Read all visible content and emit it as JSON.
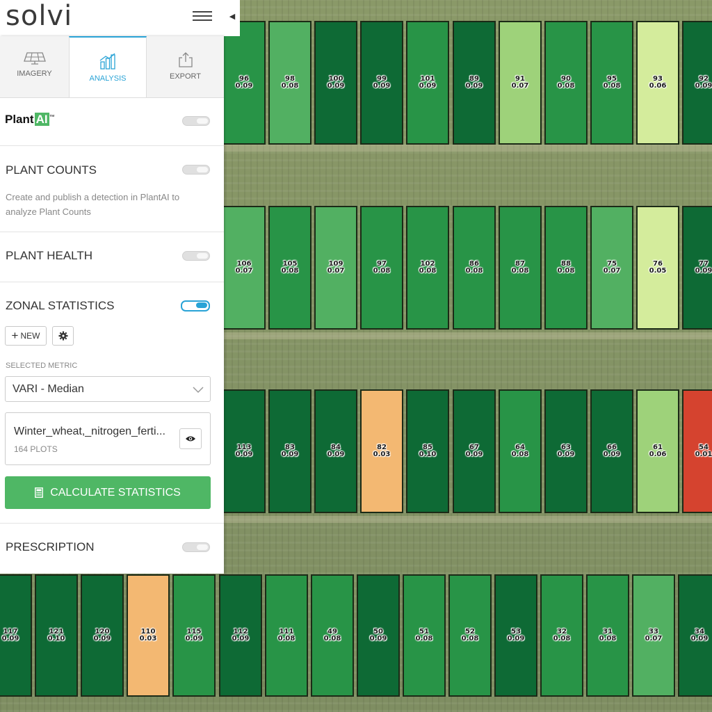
{
  "app": {
    "logo_text": "solvi"
  },
  "tabs": [
    {
      "label": "IMAGERY",
      "icon": "solar-panel-icon"
    },
    {
      "label": "ANALYSIS",
      "icon": "analysis-chart-icon",
      "active": true
    },
    {
      "label": "EXPORT",
      "icon": "export-share-icon"
    }
  ],
  "plantai": {
    "brand_plant": "Plant",
    "brand_ai": "AI",
    "trademark": "™",
    "enabled": false
  },
  "plant_counts": {
    "title": "PLANT COUNTS",
    "enabled": false,
    "description": "Create and publish a detection in PlantAI to analyze Plant Counts"
  },
  "plant_health": {
    "title": "PLANT HEALTH",
    "enabled": false
  },
  "zonal_statistics": {
    "title": "ZONAL STATISTICS",
    "enabled": true,
    "new_label": "NEW",
    "selected_metric_label": "SELECTED METRIC",
    "metric_value": "VARI - Median",
    "layer_name": "Winter_wheat,_nitrogen_ferti...",
    "plots_count": "164 PLOTS",
    "calculate_label": "CALCULATE STATISTICS"
  },
  "prescription": {
    "title": "PRESCRIPTION",
    "enabled": false
  },
  "colors": {
    "accent": "#29a3d6",
    "button_green": "#4fb765",
    "plot_dark": "#0e6a35",
    "plot_mid": "#289447",
    "plot_light": "#52b062",
    "plot_pale": "#9ed27a",
    "plot_yellowgreen": "#d4ec9c",
    "plot_orange": "#f3b872",
    "plot_red": "#d5432f"
  },
  "plot_rows": [
    [
      {
        "id": "96",
        "value": "0.09",
        "shade": "mid"
      },
      {
        "id": "98",
        "value": "0.08",
        "shade": "light"
      },
      {
        "id": "100",
        "value": "0.09",
        "shade": "dark"
      },
      {
        "id": "99",
        "value": "0.09",
        "shade": "dark"
      },
      {
        "id": "101",
        "value": "0.09",
        "shade": "mid"
      },
      {
        "id": "89",
        "value": "0.09",
        "shade": "dark"
      },
      {
        "id": "91",
        "value": "0.07",
        "shade": "pale"
      },
      {
        "id": "90",
        "value": "0.08",
        "shade": "mid"
      },
      {
        "id": "95",
        "value": "0.08",
        "shade": "mid"
      },
      {
        "id": "93",
        "value": "0.06",
        "shade": "yellowgreen"
      },
      {
        "id": "92",
        "value": "0.09",
        "shade": "dark"
      }
    ],
    [
      {
        "id": "106",
        "value": "0.07",
        "shade": "light"
      },
      {
        "id": "105",
        "value": "0.08",
        "shade": "mid"
      },
      {
        "id": "109",
        "value": "0.07",
        "shade": "light"
      },
      {
        "id": "97",
        "value": "0.08",
        "shade": "mid"
      },
      {
        "id": "102",
        "value": "0.08",
        "shade": "mid"
      },
      {
        "id": "86",
        "value": "0.08",
        "shade": "mid"
      },
      {
        "id": "87",
        "value": "0.08",
        "shade": "mid"
      },
      {
        "id": "88",
        "value": "0.08",
        "shade": "mid"
      },
      {
        "id": "75",
        "value": "0.07",
        "shade": "light"
      },
      {
        "id": "76",
        "value": "0.05",
        "shade": "yellowgreen"
      },
      {
        "id": "77",
        "value": "0.09",
        "shade": "dark"
      }
    ],
    [
      {
        "id": "113",
        "value": "0.09",
        "shade": "dark"
      },
      {
        "id": "83",
        "value": "0.09",
        "shade": "dark"
      },
      {
        "id": "84",
        "value": "0.09",
        "shade": "dark"
      },
      {
        "id": "82",
        "value": "0.03",
        "shade": "orange"
      },
      {
        "id": "85",
        "value": "0.10",
        "shade": "dark"
      },
      {
        "id": "67",
        "value": "0.09",
        "shade": "dark"
      },
      {
        "id": "64",
        "value": "0.08",
        "shade": "mid"
      },
      {
        "id": "63",
        "value": "0.09",
        "shade": "dark"
      },
      {
        "id": "66",
        "value": "0.09",
        "shade": "dark"
      },
      {
        "id": "61",
        "value": "0.06",
        "shade": "pale"
      },
      {
        "id": "54",
        "value": "0.01",
        "shade": "red"
      }
    ],
    [
      {
        "id": "117",
        "value": "0.09",
        "shade": "dark"
      },
      {
        "id": "121",
        "value": "0.10",
        "shade": "dark"
      },
      {
        "id": "120",
        "value": "0.09",
        "shade": "dark"
      },
      {
        "id": "110",
        "value": "0.03",
        "shade": "orange"
      },
      {
        "id": "115",
        "value": "0.09",
        "shade": "mid"
      },
      {
        "id": "112",
        "value": "0.09",
        "shade": "dark"
      },
      {
        "id": "111",
        "value": "0.08",
        "shade": "mid"
      },
      {
        "id": "49",
        "value": "0.08",
        "shade": "mid"
      },
      {
        "id": "50",
        "value": "0.09",
        "shade": "dark"
      },
      {
        "id": "51",
        "value": "0.08",
        "shade": "mid"
      },
      {
        "id": "52",
        "value": "0.08",
        "shade": "mid"
      },
      {
        "id": "53",
        "value": "0.09",
        "shade": "dark"
      },
      {
        "id": "32",
        "value": "0.08",
        "shade": "mid"
      },
      {
        "id": "31",
        "value": "0.08",
        "shade": "mid"
      },
      {
        "id": "33",
        "value": "0.07",
        "shade": "light"
      },
      {
        "id": "34",
        "value": "0.09",
        "shade": "dark"
      }
    ]
  ]
}
